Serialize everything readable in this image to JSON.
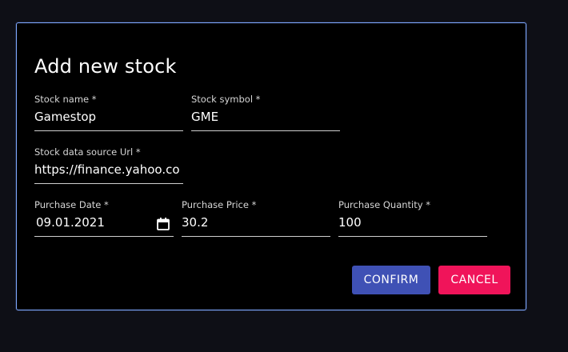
{
  "dialog": {
    "title": "Add new stock",
    "fields": {
      "stock_name": {
        "label": "Stock name *",
        "value": "Gamestop"
      },
      "stock_symbol": {
        "label": "Stock symbol *",
        "value": "GME"
      },
      "data_source_url": {
        "label": "Stock data source Url *",
        "value": "https://finance.yahoo.co"
      },
      "purchase_date": {
        "label": "Purchase Date *",
        "value": "09.01.2021"
      },
      "purchase_price": {
        "label": "Purchase Price *",
        "value": "30.2"
      },
      "purchase_quantity": {
        "label": "Purchase Quantity *",
        "value": "100"
      }
    },
    "buttons": {
      "confirm": "CONFIRM",
      "cancel": "CANCEL"
    }
  },
  "icons": {
    "date_picker": "calendar-icon"
  },
  "colors": {
    "dialog_border": "#7fa8ff",
    "confirm_button": "#3f51b5",
    "cancel_button": "#f0145a"
  }
}
